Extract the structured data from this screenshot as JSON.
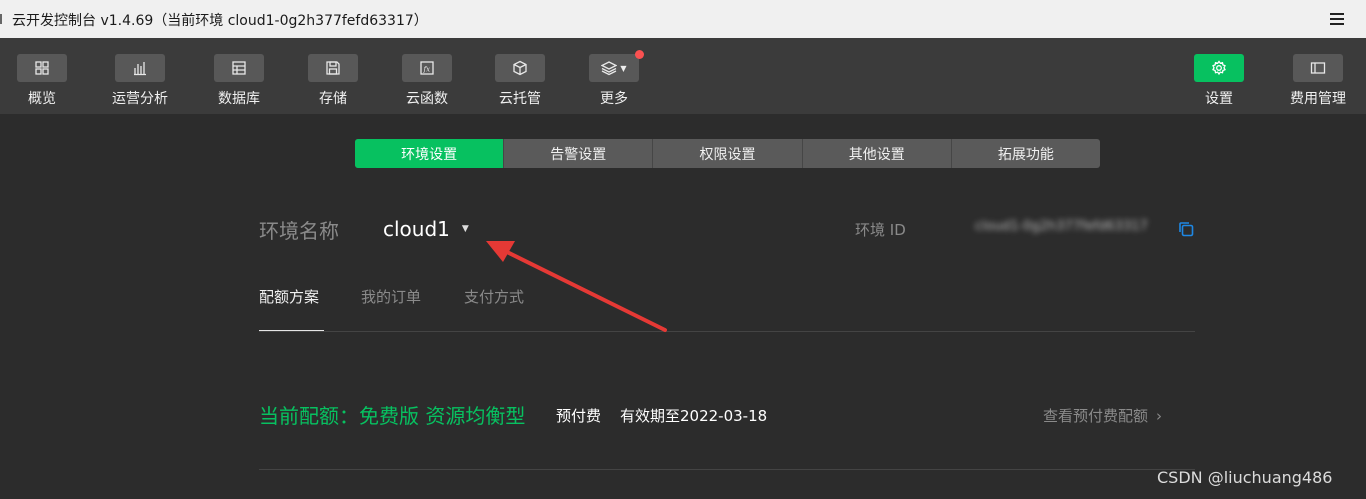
{
  "window": {
    "title": "云开发控制台 v1.4.69（当前环境 cloud1-0g2h377fefd63317）"
  },
  "toolbar": {
    "left": [
      {
        "label": "概览",
        "icon": "grid-icon"
      },
      {
        "label": "运营分析",
        "icon": "bar-chart-icon"
      },
      {
        "label": "数据库",
        "icon": "database-icon"
      },
      {
        "label": "存储",
        "icon": "storage-icon"
      },
      {
        "label": "云函数",
        "icon": "function-icon"
      },
      {
        "label": "云托管",
        "icon": "cube-icon"
      },
      {
        "label": "更多",
        "icon": "layers-icon"
      }
    ],
    "right": [
      {
        "label": "设置",
        "icon": "gear-icon"
      },
      {
        "label": "费用管理",
        "icon": "billing-icon"
      }
    ]
  },
  "settings_tabs": [
    "环境设置",
    "告警设置",
    "权限设置",
    "其他设置",
    "拓展功能"
  ],
  "env": {
    "name_label": "环境名称",
    "name_value": "cloud1",
    "id_label": "环境 ID",
    "id_value": "cloud1-0g2h377fefd63317"
  },
  "sub_tabs": [
    "配额方案",
    "我的订单",
    "支付方式"
  ],
  "quota": {
    "title": "当前配额：免费版 资源均衡型",
    "payment_type": "预付费",
    "expiry": "有效期至2022-03-18",
    "view_link": "查看预付费配额"
  },
  "watermark": "CSDN @liuchuang486",
  "colors": {
    "accent": "#07c160",
    "background": "#2c2c2c",
    "toolbar": "#3b3b3b",
    "annotation": "#e53935",
    "badge": "#fa5151"
  }
}
